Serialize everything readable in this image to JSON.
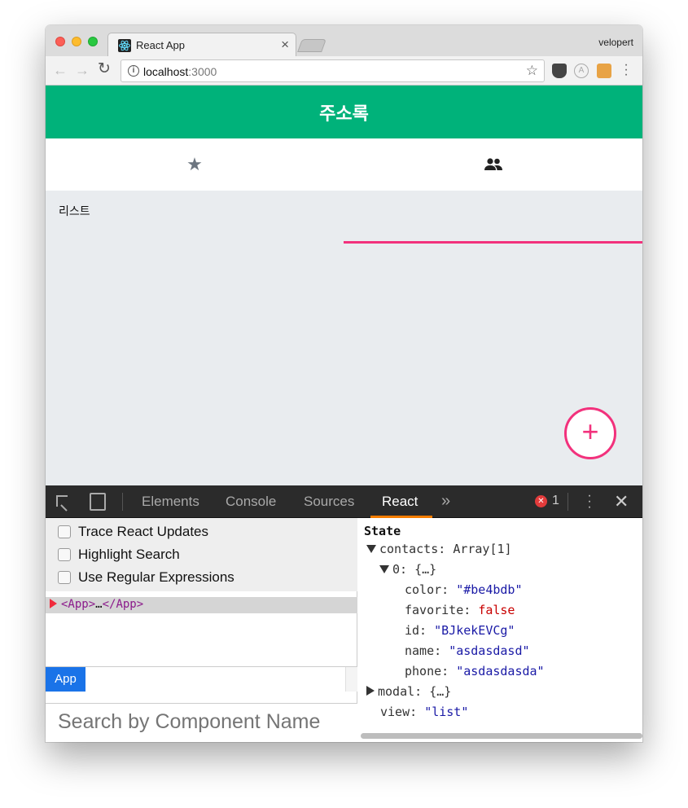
{
  "browser": {
    "tab_title": "React App",
    "tab_close": "×",
    "profile_name": "velopert",
    "url_host": "localhost",
    "url_port": ":3000",
    "extension_a_label": "A"
  },
  "app": {
    "title": "주소록",
    "tabs": [
      {
        "icon": "star-icon",
        "glyph": "★"
      },
      {
        "icon": "people-icon",
        "glyph": "👥"
      }
    ],
    "list_label": "리스트",
    "fab_label": "+",
    "colors": {
      "header": "#00b27a",
      "accent": "#f2317c",
      "background": "#e9ecef"
    }
  },
  "devtools": {
    "tabs": [
      "Elements",
      "Console",
      "Sources",
      "React"
    ],
    "active_tab": "React",
    "more_label": "»",
    "error_count": "1",
    "options": [
      "Trace React Updates",
      "Highlight Search",
      "Use Regular Expressions"
    ],
    "tree": {
      "open": "<App>",
      "ellipsis": "…",
      "close": "</App>"
    },
    "breadcrumb": "App",
    "search_placeholder": "Search by Component Name",
    "state": {
      "title": "State",
      "contacts_key": "contacts:",
      "contacts_val": "Array[1]",
      "item_key": "0:",
      "item_val": "{…}",
      "color_key": "color:",
      "color_val": "\"#be4bdb\"",
      "favorite_key": "favorite:",
      "favorite_val": "false",
      "id_key": "id:",
      "id_val": "\"BJkekEVCg\"",
      "name_key": "name:",
      "name_val": "\"asdasdasd\"",
      "phone_key": "phone:",
      "phone_val": "\"asdasdasda\"",
      "modal_key": "modal:",
      "modal_val": "{…}",
      "view_key": "view:",
      "view_val": "\"list\""
    }
  }
}
